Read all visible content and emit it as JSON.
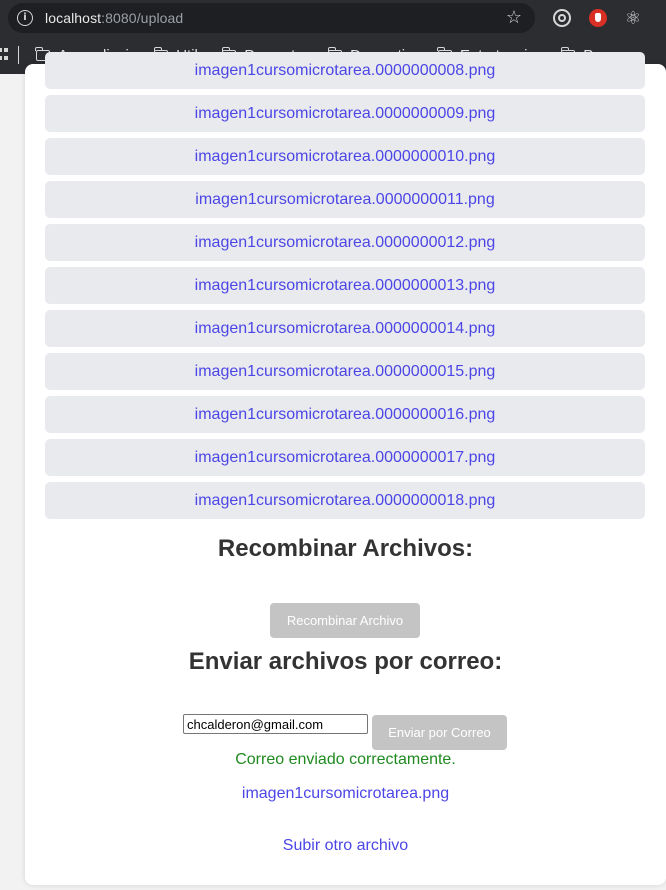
{
  "browser": {
    "url_host": "localhost",
    "url_rest": ":8080/upload",
    "bookmarks": [
      "Aprendizaje",
      "Utils",
      "Proyectos",
      "Domestico",
      "Entretencion",
      "Pegas"
    ]
  },
  "files": [
    "imagen1cursomicrotarea.0000000008.png",
    "imagen1cursomicrotarea.0000000009.png",
    "imagen1cursomicrotarea.0000000010.png",
    "imagen1cursomicrotarea.0000000011.png",
    "imagen1cursomicrotarea.0000000012.png",
    "imagen1cursomicrotarea.0000000013.png",
    "imagen1cursomicrotarea.0000000014.png",
    "imagen1cursomicrotarea.0000000015.png",
    "imagen1cursomicrotarea.0000000016.png",
    "imagen1cursomicrotarea.0000000017.png",
    "imagen1cursomicrotarea.0000000018.png"
  ],
  "recombine": {
    "title": "Recombinar Archivos:",
    "button_label": "Recombinar Archivo"
  },
  "email": {
    "title": "Enviar archivos por correo:",
    "input_value": "chcalderon@gmail.com",
    "button_label": "Enviar por Correo",
    "success_message": "Correo enviado correctamente."
  },
  "result_file": "imagen1cursomicrotarea.png",
  "upload_another": "Subir otro archivo"
}
